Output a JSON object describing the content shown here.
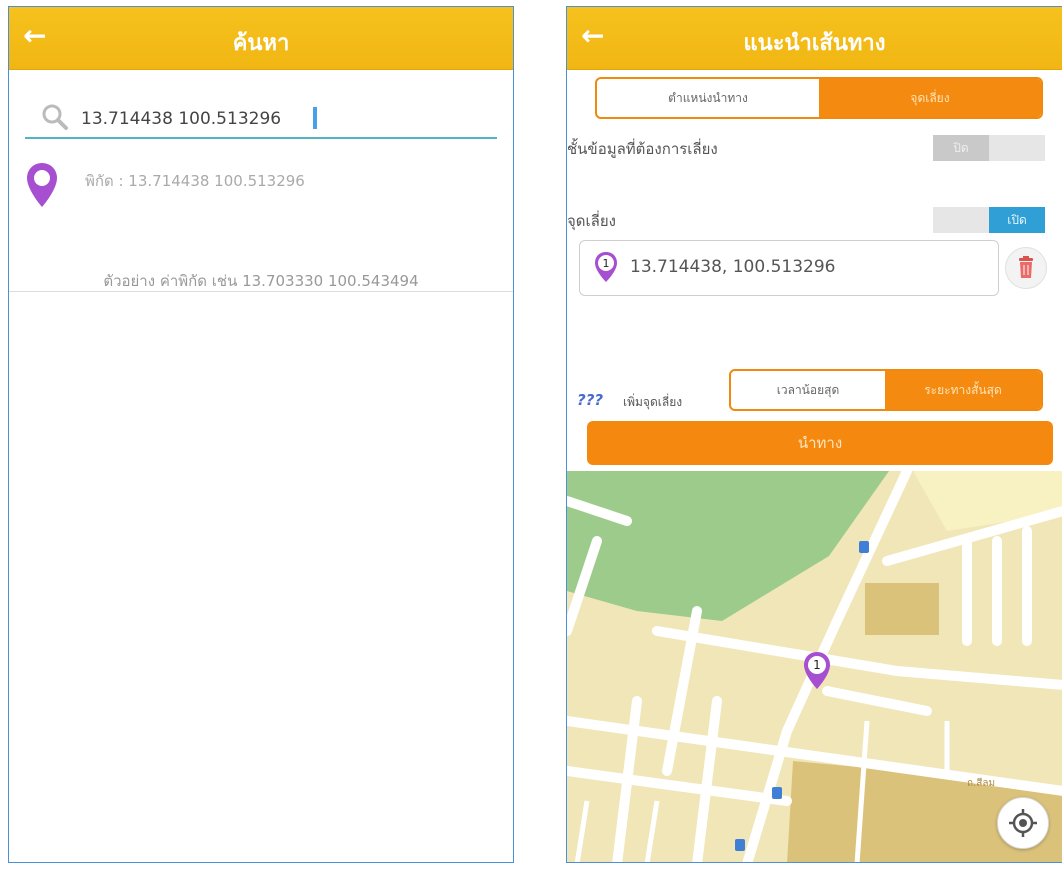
{
  "left": {
    "back_icon": "←",
    "title": "ค้นหา",
    "search": {
      "value": "13.714438 100.513296",
      "icon": "search-icon"
    },
    "result": {
      "text": "พิกัด : 13.714438 100.513296",
      "icon": "map-pin-icon"
    },
    "hint": "ตัวอย่าง ค่าพิกัด เช่น 13.703330 100.543494"
  },
  "right": {
    "back_icon": "←",
    "title": "แนะนำเส้นทาง",
    "mode_tabs": [
      {
        "label": "ตำแหน่งนำทาง",
        "active": false
      },
      {
        "label": "จุดเลี่ยง",
        "active": true
      }
    ],
    "avoid_info": {
      "label": "ชั้นข้อมูลที่ต้องการเลี่ยง",
      "toggle_label": "ปิด",
      "on": false
    },
    "avoid_point": {
      "label": "จุดเลี่ยง",
      "toggle_label": "เปิด",
      "on": true
    },
    "waypoint": {
      "index": "1",
      "value": "13.714438, 100.513296"
    },
    "add_waypoint": {
      "icon": "???",
      "label": "เพิ่มจุดเลี่ยง"
    },
    "route_options": [
      {
        "label": "เวลาน้อยสุด",
        "active": false
      },
      {
        "label": "ระยะทางสั้นสุด",
        "active": true
      }
    ],
    "navigate_label": "นำทาง",
    "map": {
      "pin_label": "1",
      "road_label": "ถ.สีลม",
      "colors": {
        "land": "#f1e6b8",
        "park": "#9ccb8c",
        "block": "#dbc27a",
        "road": "#ffffff"
      }
    }
  },
  "colors": {
    "topbar": "#f4bd18",
    "accent": "#f58a10",
    "toggle_on": "#2f9fd5",
    "pin": "#a64fd0"
  }
}
